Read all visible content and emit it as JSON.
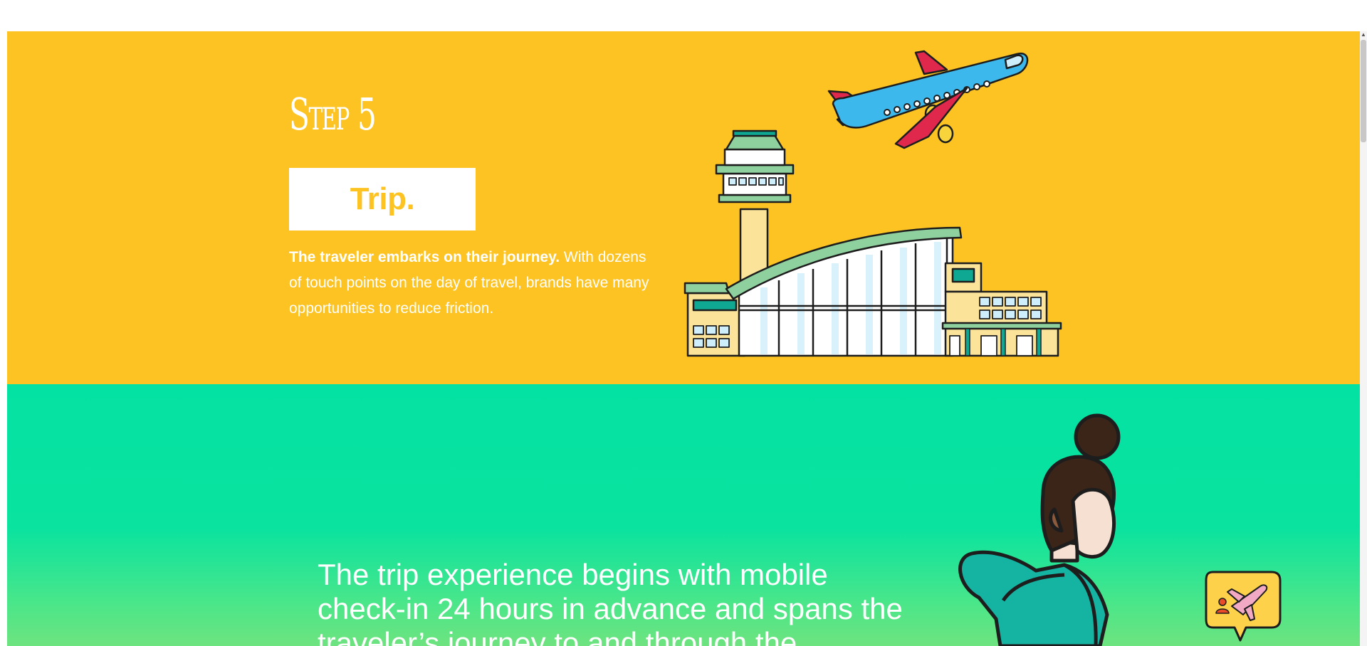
{
  "step": {
    "label": "Step 5",
    "title": "Trip.",
    "description_bold": "The traveler embarks on their journey.",
    "description_rest": " With dozens of touch points on the day of travel, brands have many opportunities to reduce friction."
  },
  "intro": {
    "text": "The trip experience begins with mobile check-in 24 hours in advance and spans the traveler’s journey to and through the"
  },
  "colors": {
    "yellow": "#fcc322",
    "green": "#04e2a3",
    "white": "#ffffff"
  },
  "icons": {
    "airplane": "airplane-illustration",
    "airport": "airport-illustration",
    "traveler": "traveler-illustration",
    "bubble": "flight-chat-bubble-icon"
  }
}
